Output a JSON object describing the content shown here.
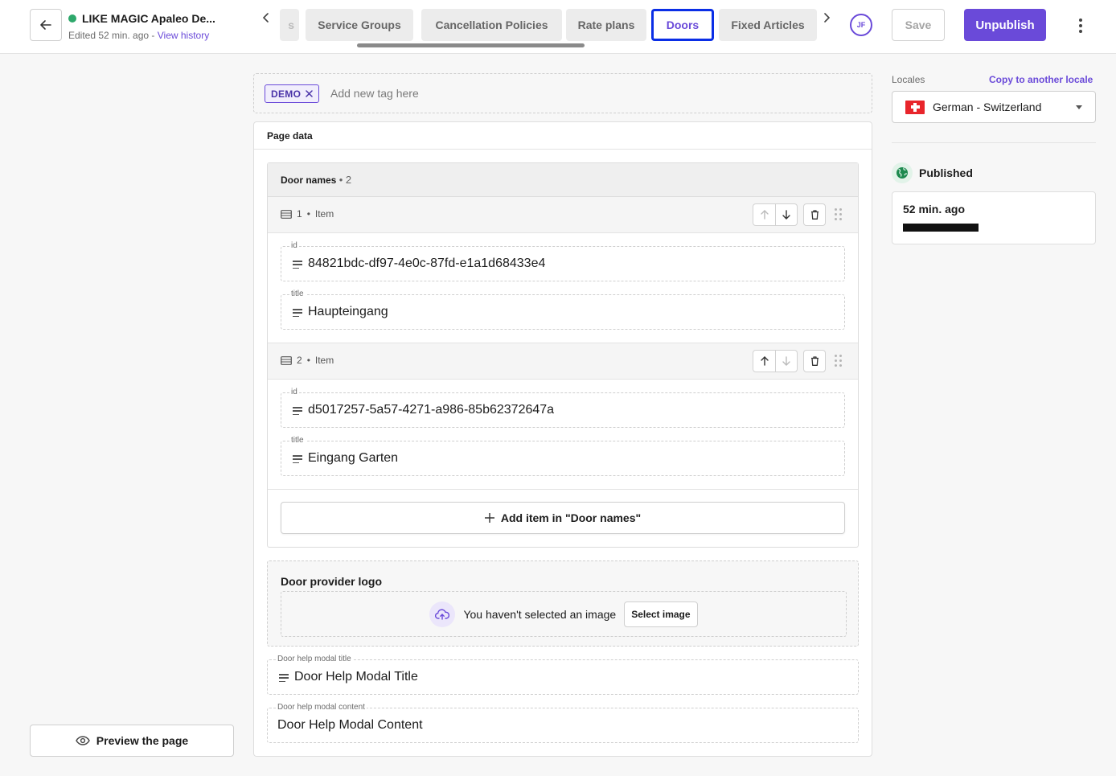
{
  "header": {
    "title": "LIKE MAGIC Apaleo De...",
    "edited": "Edited 52 min. ago - ",
    "view_history": "View history",
    "status_color": "#2ea86b"
  },
  "tabs": [
    {
      "label": "s",
      "active": false
    },
    {
      "label": "Service Groups",
      "active": false
    },
    {
      "label": "Cancellation Policies",
      "active": false
    },
    {
      "label": "Rate plans",
      "active": false
    },
    {
      "label": "Doors",
      "active": true
    },
    {
      "label": "Fixed Articles",
      "active": false
    }
  ],
  "toolbar": {
    "avatar_initials": "JF",
    "save_label": "Save",
    "unpublish_label": "Unpublish",
    "accent_color": "#6a4ad9"
  },
  "tags": {
    "chip": "DEMO",
    "placeholder": "Add new tag here"
  },
  "page_data": {
    "title": "Page data",
    "door_names": {
      "label": "Door names",
      "count": "2",
      "items": [
        {
          "index": "1",
          "type": "Item",
          "id_label": "id",
          "id_value": "84821bdc-df97-4e0c-87fd-e1a1d68433e4",
          "title_label": "title",
          "title_value": "Haupteingang"
        },
        {
          "index": "2",
          "type": "Item",
          "id_label": "id",
          "id_value": "d5017257-5a57-4271-a986-85b62372647a",
          "title_label": "title",
          "title_value": "Eingang Garten"
        }
      ],
      "add_item_label": "Add item in \"Door names\""
    },
    "door_provider_logo": {
      "label": "Door provider logo",
      "empty_text": "You haven't selected an image",
      "select_label": "Select image"
    },
    "help_modal_title": {
      "label": "Door help modal title",
      "value": "Door Help Modal Title"
    },
    "help_modal_content": {
      "label": "Door help modal content",
      "value": "Door Help Modal Content"
    }
  },
  "sidebar_left": {
    "preview_label": "Preview the page"
  },
  "sidebar_right": {
    "locales_label": "Locales",
    "copy_label": "Copy to another locale",
    "locale_value": "German - Switzerland",
    "published_label": "Published",
    "published_time": "52 min. ago"
  }
}
